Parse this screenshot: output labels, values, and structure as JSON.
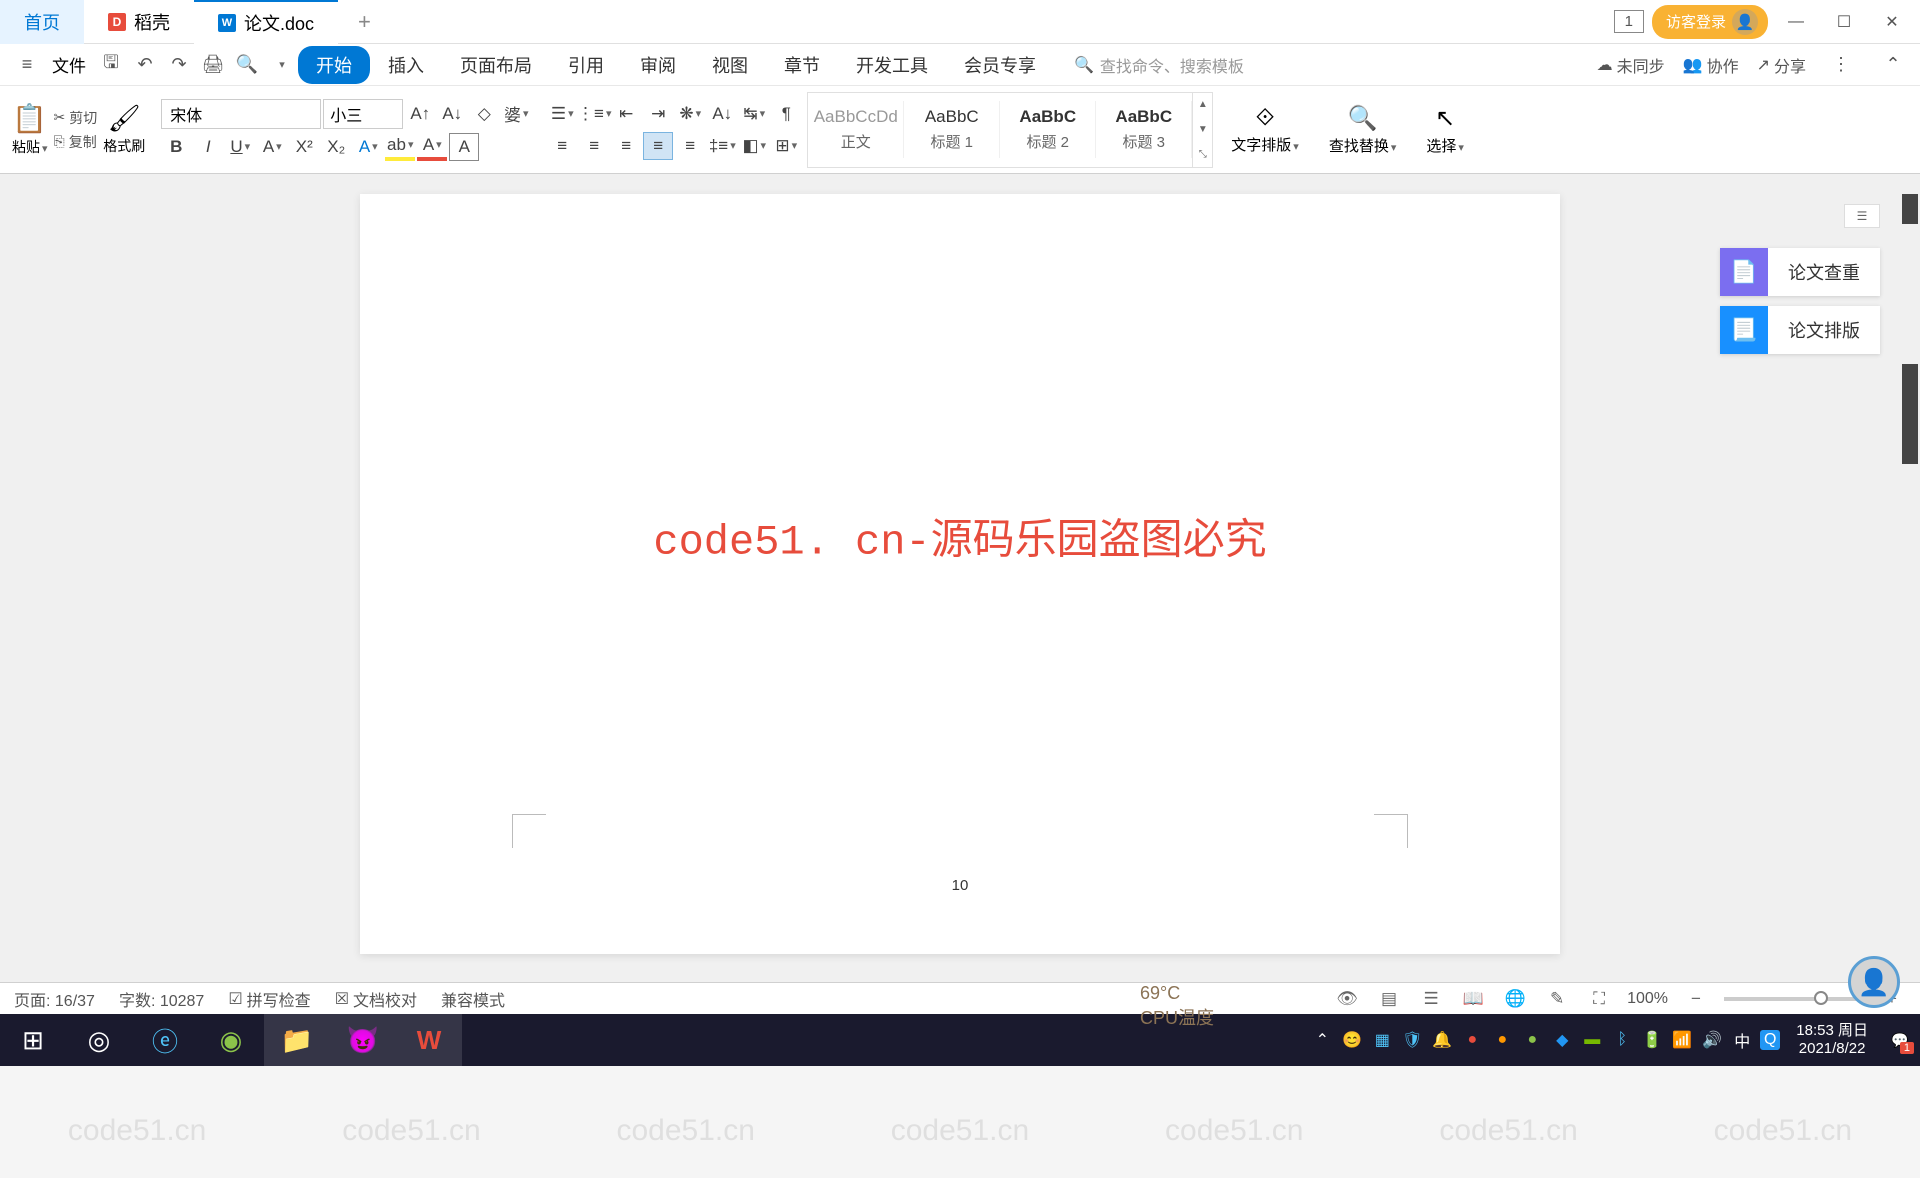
{
  "watermark_text": "code51.cn",
  "titlebar": {
    "tabs": [
      {
        "label": "首页",
        "type": "home"
      },
      {
        "label": "稻壳",
        "icon": "D"
      },
      {
        "label": "论文.doc",
        "icon": "W",
        "active": true
      }
    ],
    "count_badge": "1",
    "login": "访客登录"
  },
  "menubar": {
    "file": "文件",
    "tabs": [
      "开始",
      "插入",
      "页面布局",
      "引用",
      "审阅",
      "视图",
      "章节",
      "开发工具",
      "会员专享"
    ],
    "search_placeholder": "查找命令、搜索模板",
    "right": {
      "sync": "未同步",
      "collab": "协作",
      "share": "分享"
    }
  },
  "ribbon": {
    "paste": "粘贴",
    "cut": "剪切",
    "copy": "复制",
    "format_brush": "格式刷",
    "font_name": "宋体",
    "font_size": "小三",
    "styles": [
      {
        "preview": "AaBbCcDd",
        "label": "正文"
      },
      {
        "preview": "AaBbC",
        "label": "标题 1"
      },
      {
        "preview": "AaBbC",
        "label": "标题 2",
        "bold": true
      },
      {
        "preview": "AaBbC",
        "label": "标题 3",
        "bold": true
      }
    ],
    "text_layout": "文字排版",
    "find_replace": "查找替换",
    "select": "选择"
  },
  "side_panel": {
    "items": [
      {
        "label": "论文查重",
        "color": "purple"
      },
      {
        "label": "论文排版",
        "color": "blue"
      }
    ]
  },
  "document": {
    "watermark_line": "code51. cn-源码乐园盗图必究",
    "page_number": "10"
  },
  "statusbar": {
    "page": "页面: 16/37",
    "words": "字数: 10287",
    "spell": "拼写检查",
    "proof": "文档校对",
    "compat": "兼容模式",
    "zoom": "100%"
  },
  "taskbar": {
    "cpu_label": "CPU温度",
    "cpu_value": "69°C",
    "clock_time": "18:53 周日",
    "clock_date": "2021/8/22",
    "notif_count": "1",
    "ime": "中"
  }
}
